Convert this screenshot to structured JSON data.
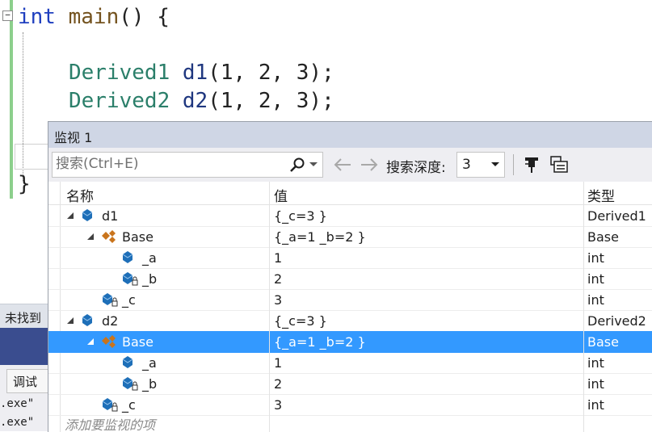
{
  "editor": {
    "line1": {
      "kw": "int",
      "fn": "main",
      "rest": "() {"
    },
    "line2": {
      "type": "Derived1",
      "var": "d1",
      "args": "(1, 2, 3);"
    },
    "line3": {
      "type": "Derived2",
      "var": "d2",
      "args": "(1, 2, 3);"
    },
    "closing_brace": "}",
    "collapse_glyph": "⊟"
  },
  "output_panel": {
    "header_text": "未找到",
    "debug_tab": "调试",
    "lines": [
      ".exe\"",
      ".exe\""
    ]
  },
  "watch": {
    "title": "监视 1",
    "search_placeholder": "搜索(Ctrl+E)",
    "depth_label": "搜索深度:",
    "depth_value": "3",
    "columns": {
      "name": "名称",
      "value": "值",
      "type": "类型"
    },
    "rows": [
      {
        "name": "d1",
        "value": "{_c=3 }",
        "type": "Derived1"
      },
      {
        "name": "Base",
        "value": "{_a=1 _b=2 }",
        "type": "Base"
      },
      {
        "name": "_a",
        "value": "1",
        "type": "int"
      },
      {
        "name": "_b",
        "value": "2",
        "type": "int"
      },
      {
        "name": "_c",
        "value": "3",
        "type": "int"
      },
      {
        "name": "d2",
        "value": "{_c=3 }",
        "type": "Derived2"
      },
      {
        "name": "Base",
        "value": "{_a=1 _b=2 }",
        "type": "Base"
      },
      {
        "name": "_a",
        "value": "1",
        "type": "int"
      },
      {
        "name": "_b",
        "value": "2",
        "type": "int"
      },
      {
        "name": "_c",
        "value": "3",
        "type": "int"
      }
    ],
    "add_item_placeholder": "添加要监视的项",
    "selected_row": 6
  },
  "colors": {
    "selection": "#3399ff",
    "title_bar": "#cfd6e5",
    "object_icon": "#1e6fb8",
    "base_icon": "#c9741c"
  }
}
